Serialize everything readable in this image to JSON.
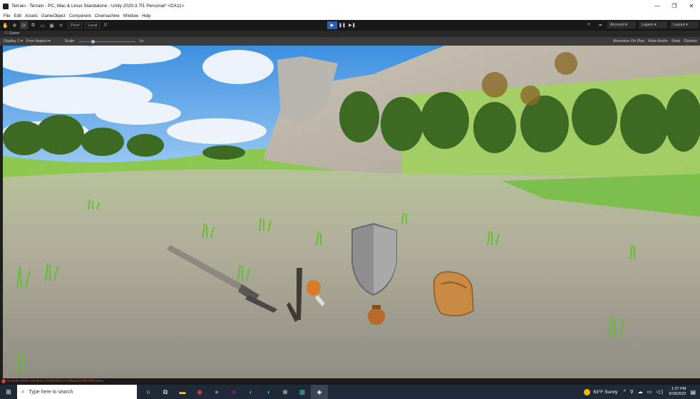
{
  "window": {
    "title": "Terrain - Terrain - PC, Mac & Linux Standalone - Unity 2020.3.7f1 Personal* <DX11>",
    "min": "—",
    "max": "❐",
    "close": "✕"
  },
  "menu": [
    "File",
    "Edit",
    "Assets",
    "GameObject",
    "Component",
    "Cinemachine",
    "Window",
    "Help"
  ],
  "toolbar": {
    "pivot_label": "Pivot",
    "local_label": "Local",
    "account_label": "Account",
    "layers_label": "Layers",
    "layout_label": "Layout"
  },
  "game_tab": {
    "label": "Game"
  },
  "game_bar": {
    "display": "Display 1",
    "aspect": "Free Aspect",
    "scale_label": "Scale",
    "scale_value": "1x",
    "maximize": "Maximize On Play",
    "mute": "Mute Audio",
    "stats": "Stats",
    "gizmos": "Gizmos"
  },
  "status": {
    "message": "Invalid editor window UnityEditor.FallbackEditorWindow"
  },
  "taskbar": {
    "search_placeholder": "Type here to search",
    "temperature": "63°F",
    "weather": "Sunny",
    "time": "1:37 PM",
    "date": "3/18/2022"
  },
  "colors": {
    "play_active": "#2c5fa8",
    "error": "#d23b3b",
    "taskbar": "#1f2a38"
  }
}
